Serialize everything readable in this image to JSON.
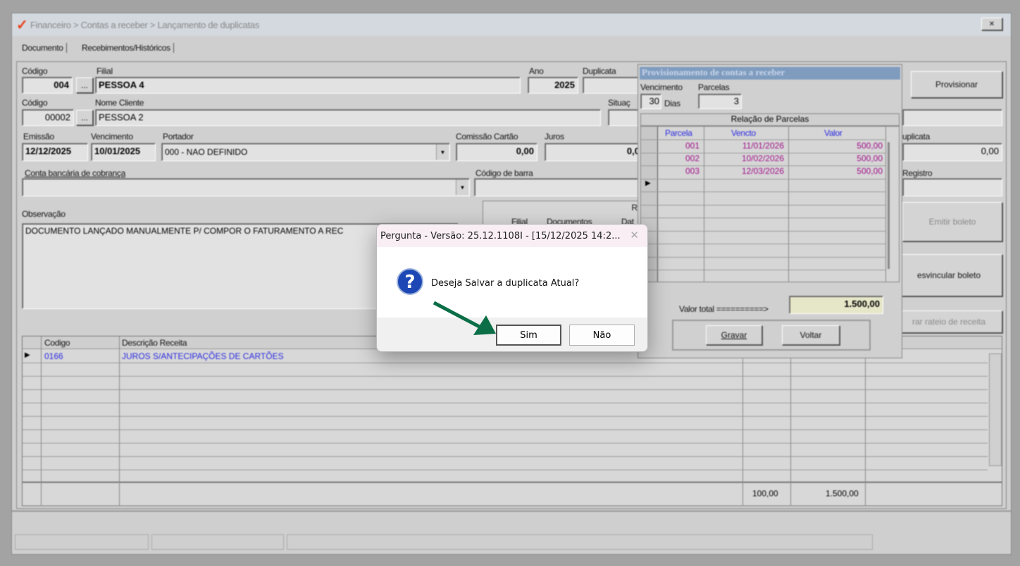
{
  "window": {
    "breadcrumb": "Financeiro > Contas a receber > Lançamento de duplicatas",
    "close": "✕"
  },
  "tabs": [
    {
      "label": "Documento"
    },
    {
      "label": "Recebimentos/Históricos"
    }
  ],
  "form": {
    "codigo_filial_label": "Código",
    "codigo_filial": "004",
    "filial_label": "Filial",
    "filial": "PESSOA 4",
    "ano_label": "Ano",
    "ano": "2025",
    "duplicata_label": "Duplicata",
    "duplicata": "",
    "codigo_cliente_label": "Código",
    "codigo_cliente": "00002",
    "nome_cliente_label": "Nome Cliente",
    "nome_cliente": "PESSOA 2",
    "situacao_label": "Situaç",
    "emissao_label": "Emissão",
    "emissao": "12/12/2025",
    "vencimento_label": "Vencimento",
    "vencimento": "10/01/2025",
    "portador_label": "Portador",
    "portador": "000 - NAO DEFINIDO",
    "comissao_label": "Comissão Cartão",
    "comissao": "0,00",
    "juros_label": "Juros",
    "juros": "0,0",
    "conta_label": "Conta bancária de cobrança",
    "codigo_barra_label": "Código de barra",
    "valor_duplicata_label": "uplicata",
    "valor_duplicata": "0,00",
    "registro_label": "Registro",
    "observacao_label": "Observação",
    "observacao": "DOCUMENTO LANÇADO MANUALMENTE P/ COMPOR O FATURAMENTO A REC",
    "ellipsis": "...",
    "dropdown": "▼"
  },
  "relacao": {
    "title": "Rela",
    "headers": [
      "Filial",
      "Documentos",
      "Dat"
    ]
  },
  "buttons": {
    "provisionar": "Provisionar",
    "emitir_boleto": "Emitir boleto",
    "desvincular_boleto": "esvincular boleto",
    "rateio": "rar rateio de receita"
  },
  "receitas": {
    "headers": [
      "Codigo",
      "Descrição Receita"
    ],
    "rows": [
      {
        "codigo": "0166",
        "descricao": "JUROS S/ANTECIPAÇÕES DE CARTÕES"
      }
    ],
    "totals": [
      "100,00",
      "1.500,00"
    ]
  },
  "provisionamento": {
    "title": "Provisionamento de contas a receber",
    "vencimento_label": "Vencimento",
    "vencimento": "30",
    "dias_label": "Dias",
    "parcelas_label": "Parcelas",
    "parcelas": "3",
    "grid_title": "Relação de Parcelas",
    "headers": [
      "Parcela",
      "Vencto",
      "Valor"
    ],
    "rows": [
      {
        "parcela": "001",
        "vencto": "11/01/2026",
        "valor": "500,00"
      },
      {
        "parcela": "002",
        "vencto": "10/02/2026",
        "valor": "500,00"
      },
      {
        "parcela": "003",
        "vencto": "12/03/2026",
        "valor": "500,00"
      }
    ],
    "valor_total_label": "Valor total ==========>",
    "valor_total": "1.500,00",
    "gravar": "Gravar",
    "voltar": "Voltar"
  },
  "dialog": {
    "title": "Pergunta - Versão: 25.12.1108I - [15/12/2025 14:2...",
    "message": "Deseja Salvar a duplicata Atual?",
    "yes": "Sim",
    "no": "Não",
    "close": "✕"
  },
  "colors": {
    "accent": "#7f9cbf",
    "link_text": "#2a2ae0",
    "parcel_text": "#a0108a",
    "arrow": "#0b6e47"
  }
}
